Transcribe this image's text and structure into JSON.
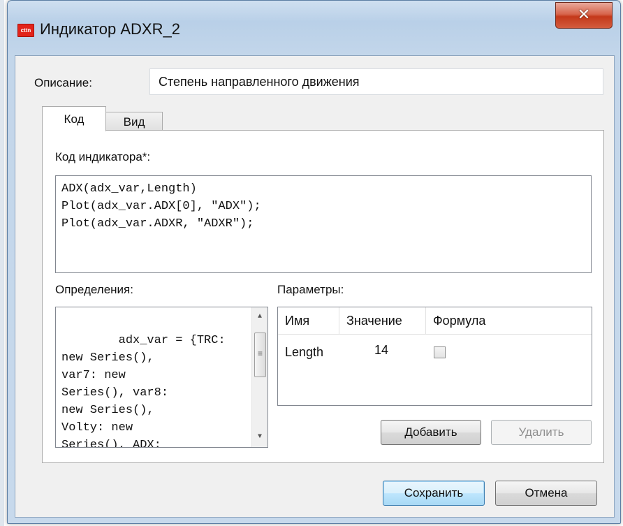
{
  "window": {
    "title": "Индикатор ADXR_2",
    "icon": "app-logo-icon",
    "close": "close-icon"
  },
  "description": {
    "label": "Описание:",
    "value": "Степень направленного движения"
  },
  "tabs": [
    {
      "label": "Код",
      "active": true
    },
    {
      "label": "Вид",
      "active": false
    }
  ],
  "code": {
    "label": "Код индикатора*:",
    "text": "ADX(adx_var,Length)\nPlot(adx_var.ADX[0], \"ADX\");\nPlot(adx_var.ADXR, \"ADXR\");"
  },
  "definitions": {
    "label": "Определения:",
    "text": "adx_var = {TRC:\nnew Series(),\nvar7: new\nSeries(), var8:\nnew Series(),\nVolty: new\nSeries(), ADX:"
  },
  "parameters": {
    "label": "Параметры:",
    "columns": [
      "Имя",
      "Значение",
      "Формула"
    ],
    "rows": [
      {
        "name": "Length",
        "value": "14",
        "formula": false
      }
    ],
    "add_label": "Добавить",
    "delete_label": "Удалить"
  },
  "footer": {
    "save_label": "Сохранить",
    "cancel_label": "Отмена"
  }
}
